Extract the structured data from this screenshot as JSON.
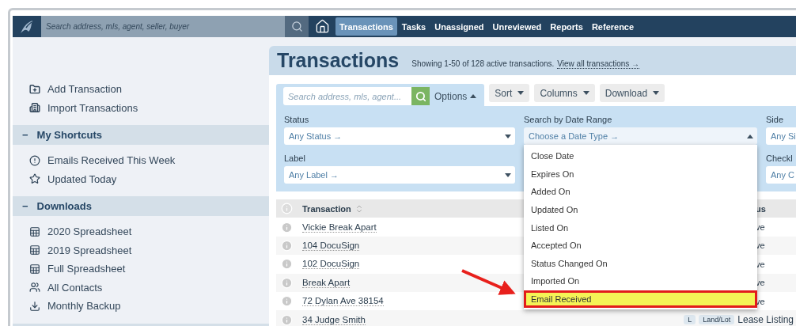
{
  "nav": {
    "search_placeholder": "Search address, mls, agent, seller, buyer",
    "tabs": [
      {
        "label": "Transactions",
        "selected": true
      },
      {
        "label": "Tasks",
        "selected": false
      },
      {
        "label": "Unassigned",
        "selected": false
      },
      {
        "label": "Unreviewed",
        "selected": false
      },
      {
        "label": "Reports",
        "selected": false
      },
      {
        "label": "Reference",
        "selected": false
      }
    ]
  },
  "sidebar": {
    "actions": [
      {
        "label": "Add Transaction"
      },
      {
        "label": "Import Transactions"
      }
    ],
    "sections": [
      {
        "toggle": "−",
        "title": "My Shortcuts",
        "items": [
          {
            "label": "Emails Received This Week"
          },
          {
            "label": "Updated Today"
          }
        ]
      },
      {
        "toggle": "−",
        "title": "Downloads",
        "items": [
          {
            "label": "2020 Spreadsheet"
          },
          {
            "label": "2019 Spreadsheet"
          },
          {
            "label": "Full Spreadsheet"
          },
          {
            "label": "All Contacts"
          },
          {
            "label": "Monthly Backup"
          }
        ]
      }
    ]
  },
  "main": {
    "title": "Transactions",
    "summary": "Showing 1-50 of 128 active transactions.",
    "view_all_link": "View all transactions →",
    "toolbar": {
      "search_placeholder": "Search address, mls, agent...",
      "options_label": "Options",
      "options_open": true,
      "buttons": [
        "Sort",
        "Columns",
        "Download"
      ]
    },
    "filter_columns": [
      [
        {
          "label": "Status",
          "value": "Any Status →",
          "open": false
        },
        {
          "label": "Label",
          "value": "Any Label →",
          "open": false
        }
      ],
      [
        {
          "label": "Search by Date Range",
          "value": "Choose a Date Type →",
          "open": true,
          "options": [
            {
              "label": "Close Date",
              "highlighted": false
            },
            {
              "label": "Expires On",
              "highlighted": false
            },
            {
              "label": "Added On",
              "highlighted": false
            },
            {
              "label": "Updated On",
              "highlighted": false
            },
            {
              "label": "Listed On",
              "highlighted": false
            },
            {
              "label": "Accepted On",
              "highlighted": false
            },
            {
              "label": "Status Changed On",
              "highlighted": false
            },
            {
              "label": "Imported On",
              "highlighted": false
            },
            {
              "label": "Email Received",
              "highlighted": true
            }
          ]
        }
      ],
      [
        {
          "label": "Side",
          "value": "Any Si",
          "open": false
        },
        {
          "label": "Checkl",
          "value": "Any C",
          "open": false
        }
      ]
    ],
    "table": {
      "columns": [
        "Transaction",
        "us"
      ],
      "rows": [
        {
          "name": "Vickie Break Apart",
          "status": "ve",
          "tags": []
        },
        {
          "name": "104 DocuSign",
          "status": "ve",
          "tags": []
        },
        {
          "name": "102 DocuSign",
          "status": "ve",
          "tags": []
        },
        {
          "name": "Break Apart",
          "status": "ve",
          "tags": []
        },
        {
          "name": "72 Dylan Ave 38154",
          "status": "ve",
          "tags": []
        },
        {
          "name": "34 Judge Smith",
          "status": "Lease Listing",
          "tags": [
            "L",
            "Land/Lot"
          ]
        }
      ]
    }
  }
}
